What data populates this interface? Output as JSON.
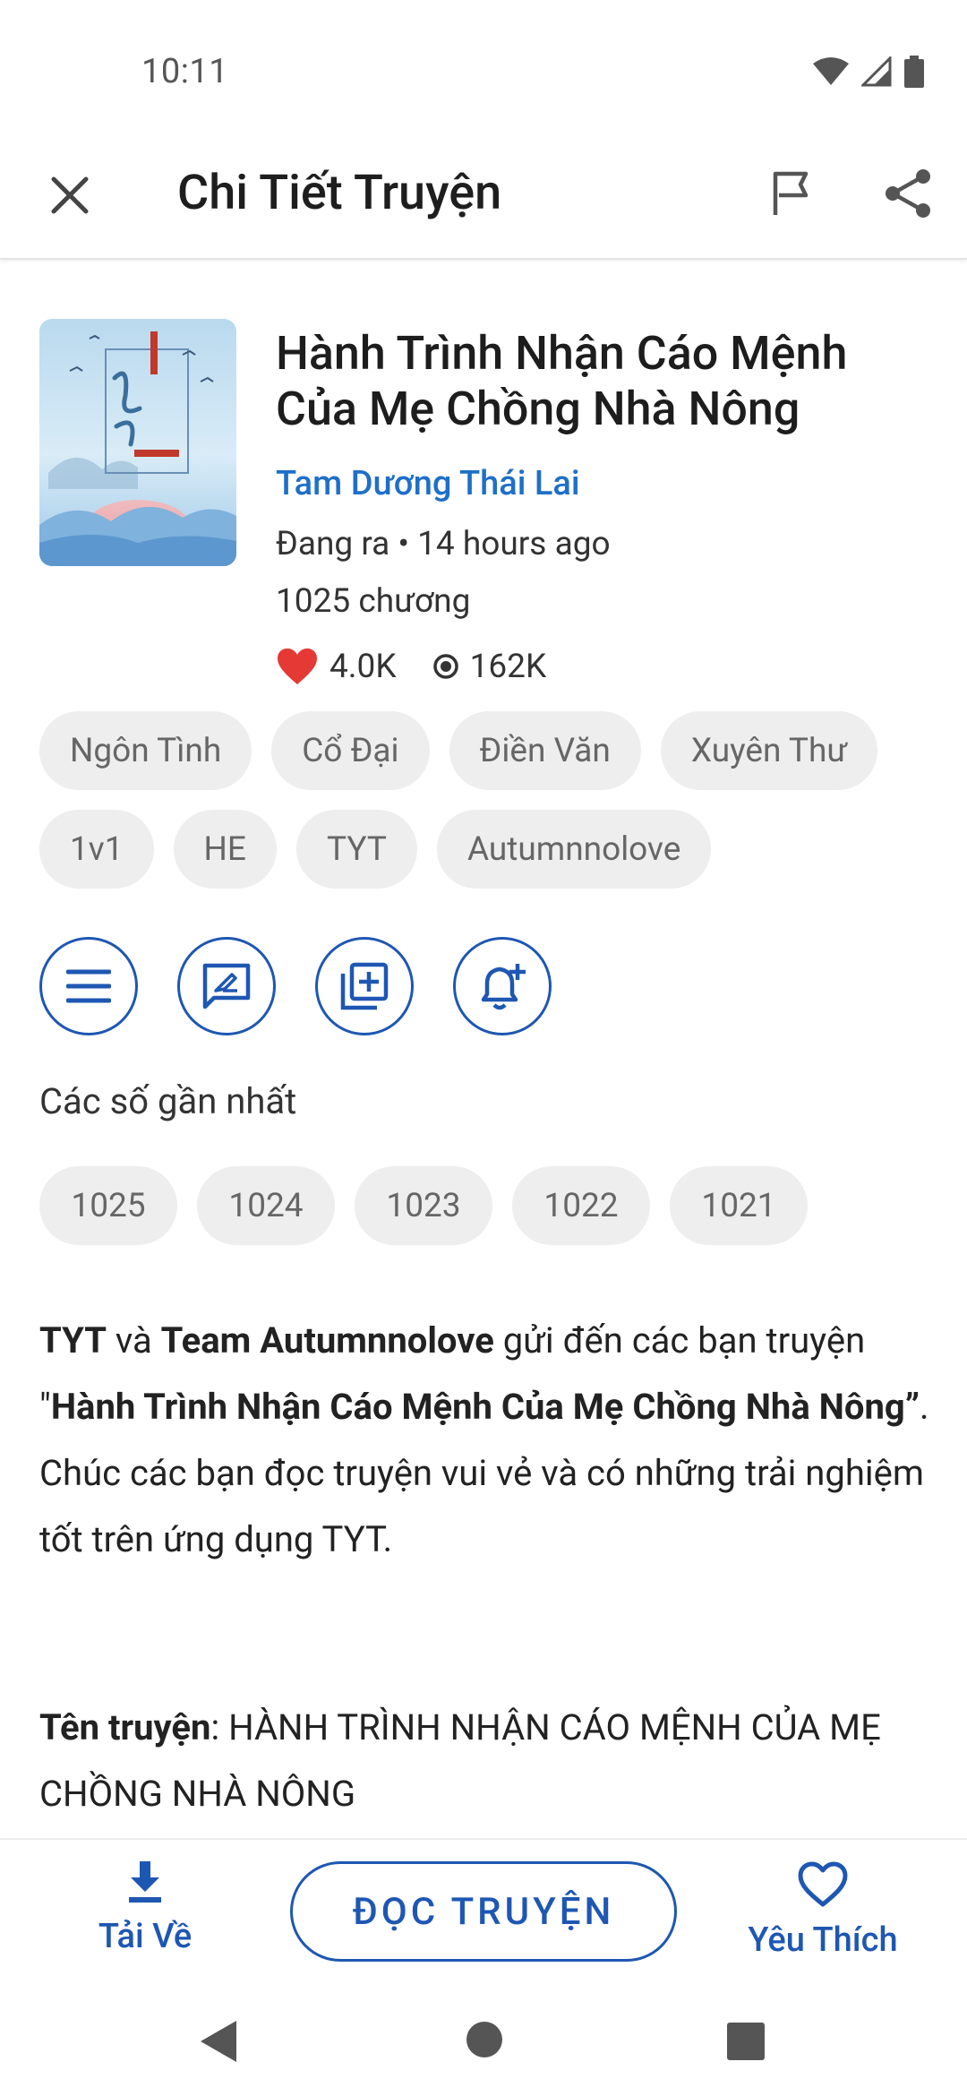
{
  "status_bar": {
    "time": "10:11"
  },
  "app_bar": {
    "title": "Chi Tiết Truyện"
  },
  "story": {
    "title": "Hành Trình Nhận Cáo Mệnh Của Mẹ Chồng Nhà Nông",
    "author": "Tam Dương Thái Lai",
    "status": "Đang ra • 14 hours ago",
    "chapters": "1025 chương",
    "likes": "4.0K",
    "views": "162K"
  },
  "tags": [
    "Ngôn Tình",
    "Cổ Đại",
    "Điền Văn",
    "Xuyên Thư",
    "1v1",
    "HE",
    "TYT",
    "Autumnnolove"
  ],
  "recent": {
    "label": "Các số gần nhất",
    "chapters": [
      "1025",
      "1024",
      "1023",
      "1022",
      "1021"
    ]
  },
  "description": {
    "p1_b1": "TYT",
    "p1_t1": " và ",
    "p1_b2": "Team Autumnnolove",
    "p1_t2": " gửi đến các bạn truyện \"",
    "p1_b3": "Hành Trình Nhận Cáo Mệnh Của Mẹ Chồng Nhà Nông”",
    "p1_t3": ". Chúc các bạn đọc truyện vui vẻ và có những trải nghiệm tốt trên ứng dụng TYT.",
    "p2_label": "Tên truyện",
    "p2_text": ": HÀNH TRÌNH NHẬN CÁO MỆNH CỦA MẸ CHỒNG NHÀ NÔNG"
  },
  "bottom_bar": {
    "download_label": "Tải Về",
    "read_label": "ĐỌC TRUYỆN",
    "favorite_label": "Yêu Thích"
  },
  "colors": {
    "accent": "#1e57b3",
    "author": "#1e6fc8",
    "chip_bg": "#eeeeee",
    "heart": "#e53935"
  },
  "icons": [
    "close-icon",
    "flag-icon",
    "share-icon",
    "heart-icon",
    "eye-icon",
    "menu-icon",
    "comment-icon",
    "add-library-icon",
    "bell-plus-icon",
    "download-icon",
    "favorite-icon"
  ]
}
